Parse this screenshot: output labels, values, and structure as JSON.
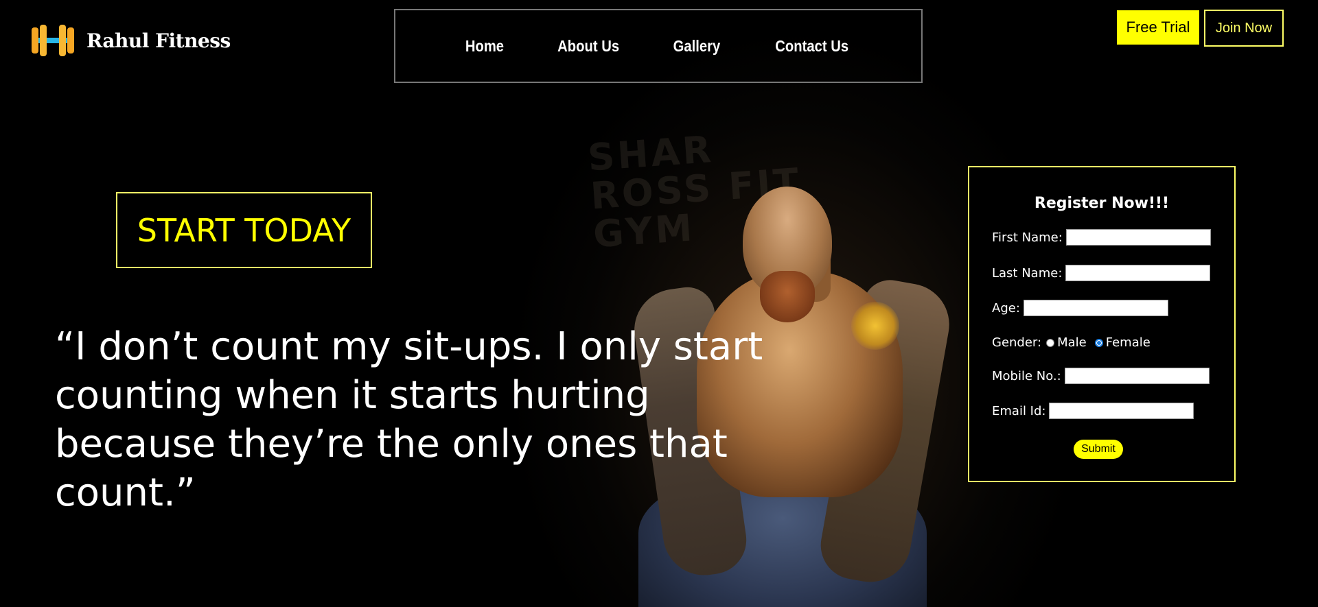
{
  "brand": {
    "name": "Rahul Fitness",
    "icon": "dumbbell-icon"
  },
  "nav": {
    "items": [
      {
        "label": "Home"
      },
      {
        "label": "About Us"
      },
      {
        "label": "Gallery"
      },
      {
        "label": "Contact Us"
      }
    ]
  },
  "header_buttons": {
    "free_trial": "Free Trial",
    "join_now": "Join Now"
  },
  "hero": {
    "cta": "START TODAY",
    "quote": "“I don’t count my sit-ups. I only start counting when it starts hurting because they’re the only ones that count.”"
  },
  "register": {
    "title": "Register Now!!!",
    "first_name_label": "First Name:",
    "last_name_label": "Last Name:",
    "age_label": "Age:",
    "gender_label": "Gender:",
    "gender_options": [
      "Male",
      "Female"
    ],
    "gender_selected": "Female",
    "mobile_label": "Mobile No.:",
    "email_label": "Email Id:",
    "submit_label": "Submit"
  },
  "colors": {
    "accent": "#ffff00",
    "background": "#000000",
    "radio_selected": "#1e7fe0"
  }
}
